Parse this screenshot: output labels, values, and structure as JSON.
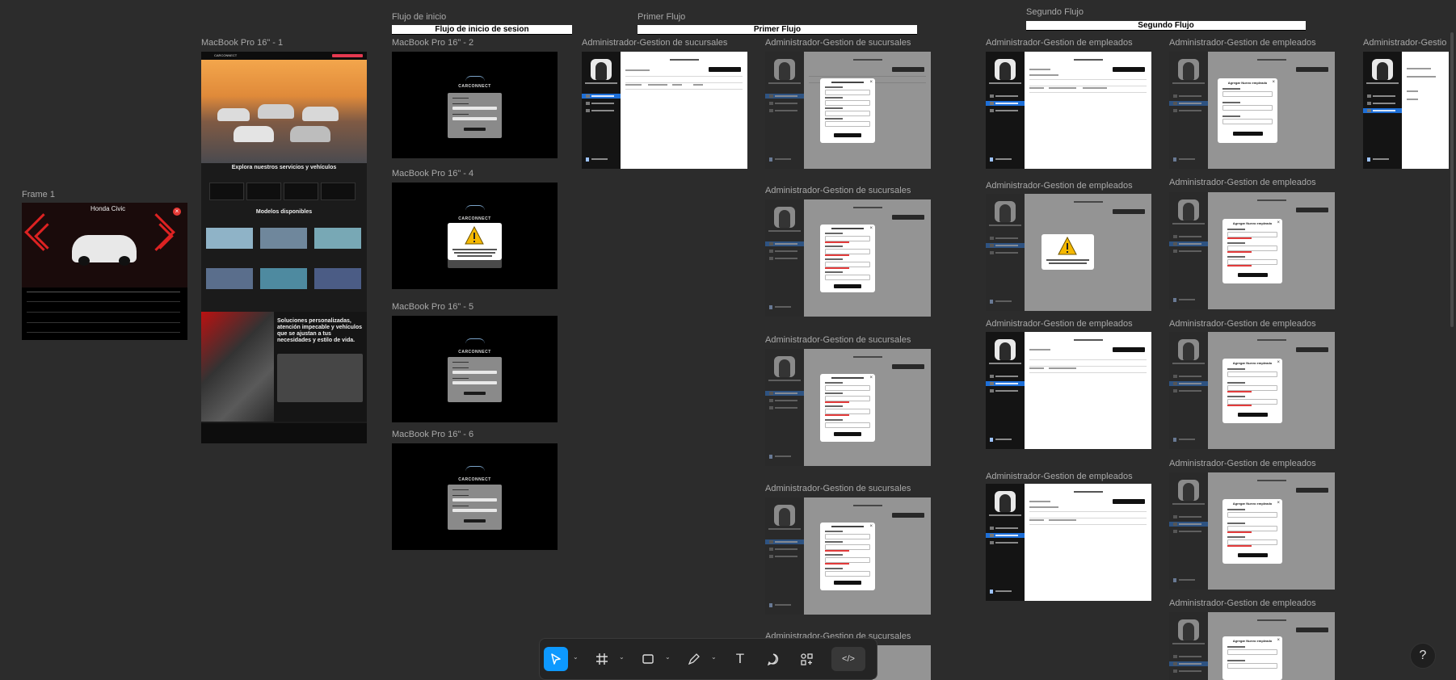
{
  "canvas": {
    "sections": {
      "flujo_inicio_label": "Flujo de inicio",
      "flujo_inicio_banner": "Flujo de inicio de sesion",
      "primer_flujo_label": "Primer Flujo",
      "primer_flujo_banner": "Primer Flujo",
      "segundo_flujo_label": "Segundo Flujo",
      "segundo_flujo_banner": "Segundo Flujo"
    },
    "frames": {
      "frame1": "Frame 1",
      "mbp1": "MacBook Pro 16\" - 1",
      "mbp2": "MacBook Pro 16\" - 2",
      "mbp4": "MacBook Pro 16\" - 4",
      "mbp5": "MacBook Pro 16\" - 5",
      "mbp6": "MacBook Pro 16\" - 6",
      "sucursales": "Administrador-Gestion de sucursales",
      "empleados": "Administrador-Gestion de empleados",
      "truncated": "Administrador-Gestio"
    },
    "frame1_content": {
      "car_title": "Honda Civic",
      "close_icon": "×"
    },
    "landing": {
      "brand": "CARCONNECT",
      "services_title": "Explora nuestros servicios y vehículos",
      "models_title": "Modelos disponibles",
      "hero_text": "Soluciones personalizadas, atención impecable y vehículos que se ajustan a tus necesidades y estilo de vida."
    },
    "login": {
      "brand": "CARCONNECT"
    },
    "empleados_modal_title": "Agregar Nuevo empleado"
  },
  "toolbar": {
    "tools": [
      "move-icon",
      "frame-icon",
      "rectangle-icon",
      "pen-icon",
      "text-icon",
      "comment-icon",
      "assets-icon",
      "code-icon"
    ],
    "active": "move-icon",
    "text_tool": "T",
    "code_tool": "</>"
  },
  "help_label": "?",
  "colors": {
    "canvas": "#2c2c2c",
    "accent": "#1d6fd8",
    "error": "#e23b3b"
  }
}
